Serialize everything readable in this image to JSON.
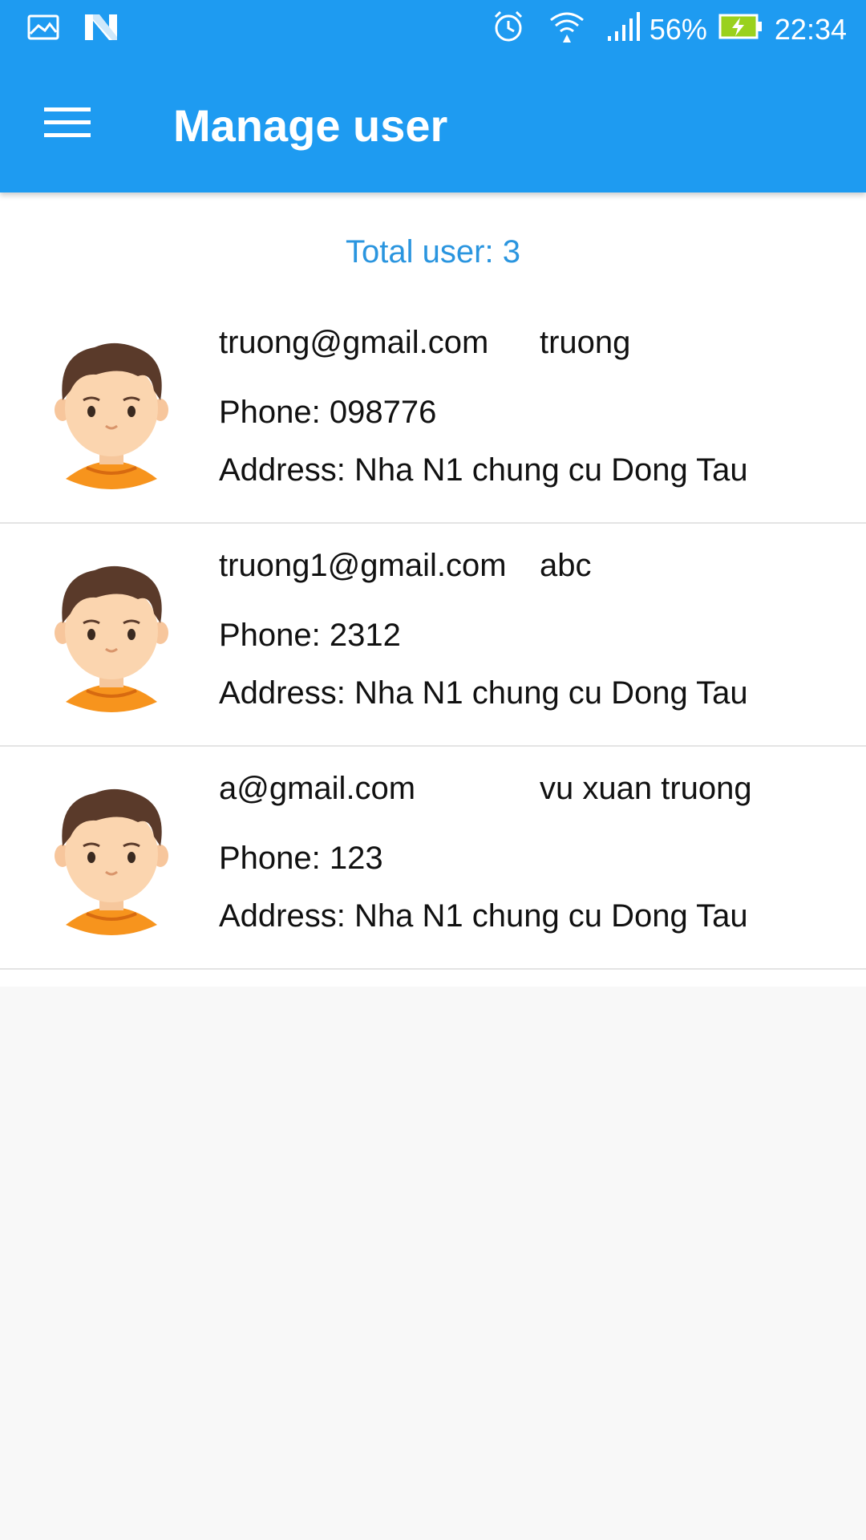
{
  "status_bar": {
    "battery_percent": "56%",
    "time": "22:34",
    "icons": [
      "gallery-icon",
      "n-logo-icon",
      "alarm-icon",
      "wifi-icon",
      "signal-icon",
      "battery-charging-icon"
    ]
  },
  "app_bar": {
    "title": "Manage user",
    "menu_icon": "hamburger-menu-icon"
  },
  "summary": {
    "total_text": "Total user: 3"
  },
  "users": [
    {
      "email": "truong@gmail.com",
      "name": "truong",
      "phone": "Phone: 098776",
      "address": "Address: Nha N1 chung cu Dong Tau"
    },
    {
      "email": "truong1@gmail.com",
      "name": "abc",
      "phone": "Phone: 2312",
      "address": "Address: Nha N1 chung cu Dong Tau"
    },
    {
      "email": "a@gmail.com",
      "name": "vu xuan truong",
      "phone": "Phone: 123",
      "address": "Address: Nha N1 chung cu Dong Tau"
    }
  ],
  "colors": {
    "primary": "#1e9bf1",
    "total_text": "#2a95df",
    "background": "#f8f8f8"
  }
}
